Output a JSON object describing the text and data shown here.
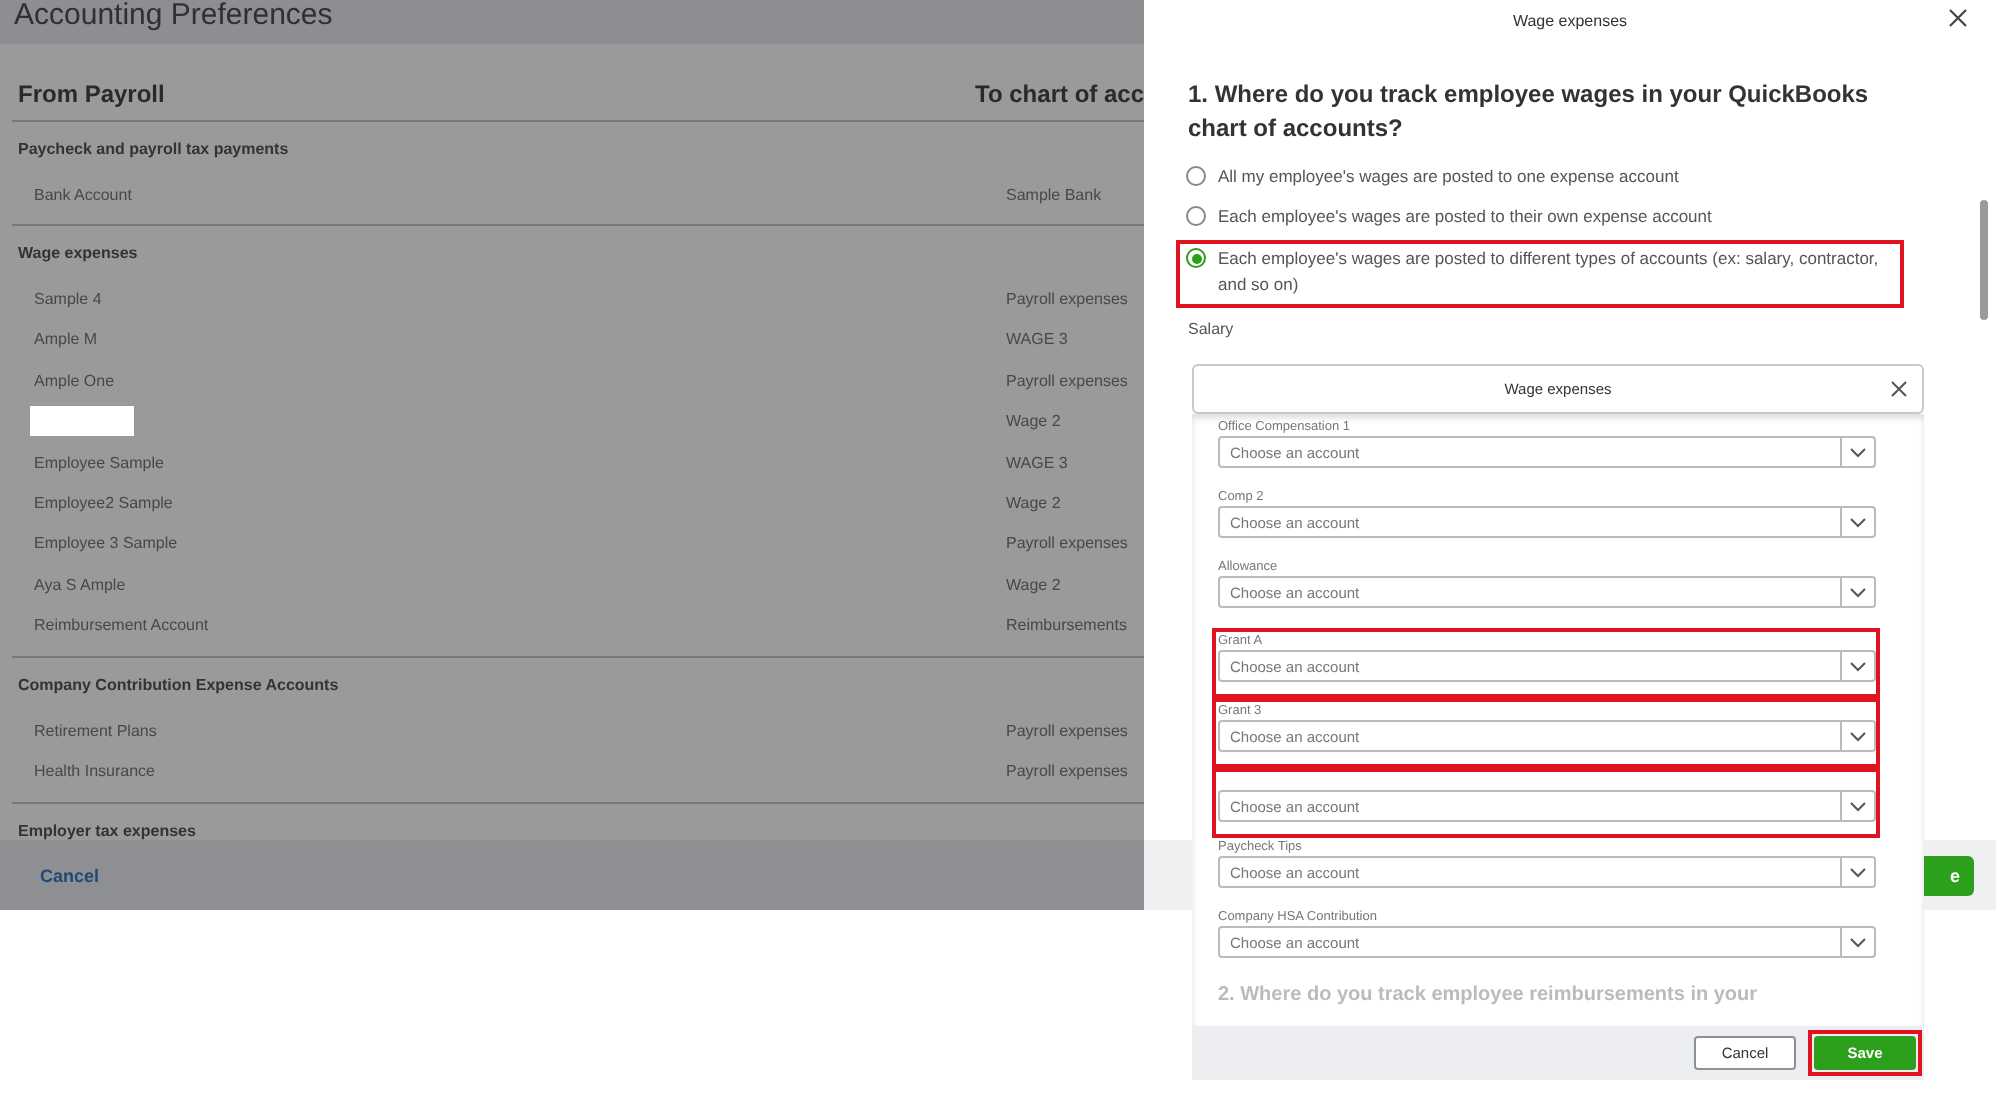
{
  "page": {
    "title": "Accounting Preferences",
    "columns": [
      "From Payroll",
      "To chart of acc"
    ],
    "sections": [
      {
        "title": "Paycheck and payroll tax payments",
        "rows": [
          {
            "item": "Bank Account",
            "account": "Sample Bank",
            "redacted": false
          }
        ]
      },
      {
        "title": "Wage expenses",
        "rows": [
          {
            "item": "Sample 4",
            "account": "Payroll expenses",
            "redacted": false
          },
          {
            "item": "Ample M",
            "account": "WAGE 3",
            "redacted": false
          },
          {
            "item": "Ample One",
            "account": "Payroll expenses",
            "redacted": false
          },
          {
            "account": "Wage 2",
            "redacted": true
          },
          {
            "item": "Employee Sample",
            "account": "WAGE 3",
            "redacted": false
          },
          {
            "item": "Employee2 Sample",
            "account": "Wage 2",
            "redacted": false
          },
          {
            "item": "Employee 3 Sample",
            "account": "Payroll expenses",
            "redacted": false
          },
          {
            "item": "Aya S Ample",
            "account": "Wage 2",
            "redacted": false
          },
          {
            "item": "Reimbursement Account",
            "account": "Reimbursements",
            "redacted": false
          }
        ]
      },
      {
        "title": "Company Contribution Expense Accounts",
        "rows": [
          {
            "item": "Retirement Plans",
            "account": "Payroll expenses",
            "redacted": false
          },
          {
            "item": "Health Insurance",
            "account": "Payroll expenses",
            "redacted": false
          }
        ]
      },
      {
        "title": "Employer tax expenses"
      }
    ],
    "cancel": "Cancel"
  },
  "panel": {
    "title": "Wage expenses",
    "question": "1. Where do you track employee wages in your QuickBooks chart of accounts?",
    "options": [
      {
        "label": "All my employee's wages are posted to one expense account",
        "selected": false,
        "highlighted": false
      },
      {
        "label": "Each employee's wages are posted to their own expense account",
        "selected": false,
        "highlighted": false
      },
      {
        "label": "Each employee's wages are posted to different types of accounts (ex: salary, contractor, and so on)",
        "selected": true,
        "highlighted": true
      }
    ],
    "field_label": "Salary",
    "save_partial": "e"
  },
  "dropdown": {
    "title": "Wage expenses",
    "fields": [
      {
        "label": "Office Compensation 1",
        "placeholder": "Choose an account",
        "highlighted": false
      },
      {
        "label": "Comp 2",
        "placeholder": "Choose an account",
        "highlighted": false
      },
      {
        "label": "Allowance",
        "placeholder": "Choose an account",
        "highlighted": false
      },
      {
        "label": "Grant A",
        "placeholder": "Choose an account",
        "highlighted": true
      },
      {
        "label": "Grant 3",
        "placeholder": "Choose an account",
        "highlighted": true
      },
      {
        "placeholder": "Choose an account",
        "highlighted": true
      },
      {
        "label": "Paycheck Tips",
        "placeholder": "Choose an account",
        "highlighted": false
      },
      {
        "label": "Company HSA Contribution",
        "placeholder": "Choose an account",
        "highlighted": false
      }
    ],
    "next_question": "2. Where do you track employee reimbursements in your",
    "buttons": [
      {
        "label": "Cancel",
        "kind": "secondary",
        "highlighted": false
      },
      {
        "label": "Save",
        "kind": "primary",
        "highlighted": true
      }
    ]
  }
}
